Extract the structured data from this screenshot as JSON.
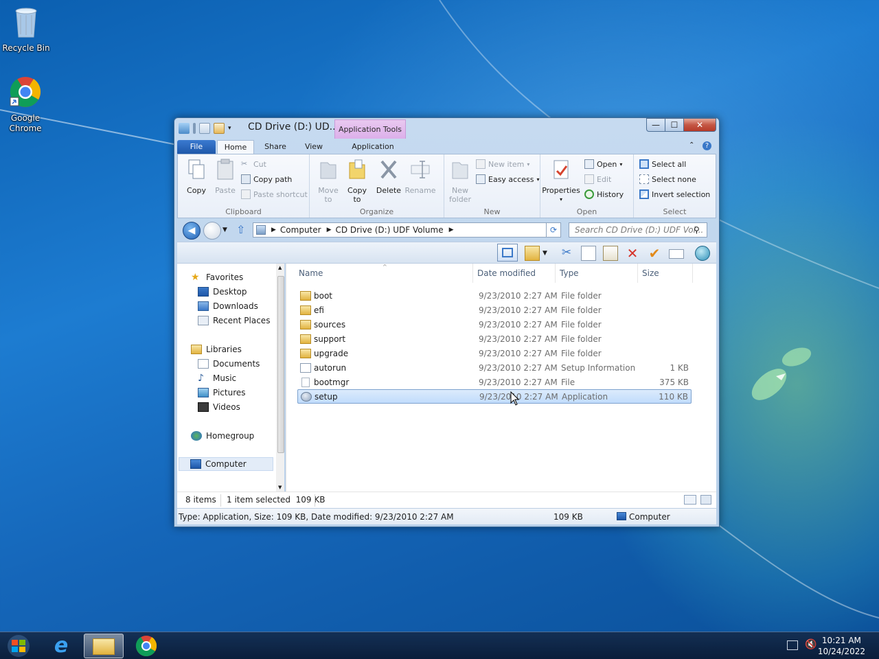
{
  "desktop": {
    "icons": [
      {
        "label": "Recycle Bin"
      },
      {
        "label": "Google Chrome"
      }
    ]
  },
  "window": {
    "title": "CD Drive (D:) UD...",
    "context_tab": "Application Tools",
    "controls": {
      "minimize": "—",
      "maximize": "☐",
      "close": "✕"
    },
    "tabs": {
      "file": "File",
      "home": "Home",
      "share": "Share",
      "view": "View",
      "application": "Application"
    }
  },
  "ribbon": {
    "clipboard": {
      "label": "Clipboard",
      "copy": "Copy",
      "paste": "Paste",
      "cut": "Cut",
      "copy_path": "Copy path",
      "paste_shortcut": "Paste shortcut"
    },
    "organize": {
      "label": "Organize",
      "move_to": "Move",
      "move_to2": "to",
      "copy_to": "Copy",
      "copy_to2": "to",
      "delete": "Delete",
      "rename": "Rename"
    },
    "new": {
      "label": "New",
      "new_folder": "New",
      "new_folder2": "folder",
      "new_item": "New item",
      "easy_access": "Easy access"
    },
    "open": {
      "label": "Open",
      "properties": "Properties",
      "open": "Open",
      "edit": "Edit",
      "history": "History"
    },
    "select": {
      "label": "Select",
      "select_all": "Select all",
      "select_none": "Select none",
      "invert": "Invert selection"
    }
  },
  "address": {
    "crumbs": [
      "Computer",
      "CD Drive (D:) UDF Volume"
    ],
    "search_placeholder": "Search CD Drive (D:) UDF Vol..."
  },
  "nav": {
    "favorites": "Favorites",
    "desktop": "Desktop",
    "downloads": "Downloads",
    "recent": "Recent Places",
    "libraries": "Libraries",
    "documents": "Documents",
    "music": "Music",
    "pictures": "Pictures",
    "videos": "Videos",
    "homegroup": "Homegroup",
    "computer": "Computer"
  },
  "columns": {
    "name": "Name",
    "date": "Date modified",
    "type": "Type",
    "size": "Size"
  },
  "files": [
    {
      "name": "boot",
      "date": "9/23/2010 2:27 AM",
      "type": "File folder",
      "size": ""
    },
    {
      "name": "efi",
      "date": "9/23/2010 2:27 AM",
      "type": "File folder",
      "size": ""
    },
    {
      "name": "sources",
      "date": "9/23/2010 2:27 AM",
      "type": "File folder",
      "size": ""
    },
    {
      "name": "support",
      "date": "9/23/2010 2:27 AM",
      "type": "File folder",
      "size": ""
    },
    {
      "name": "upgrade",
      "date": "9/23/2010 2:27 AM",
      "type": "File folder",
      "size": ""
    },
    {
      "name": "autorun",
      "date": "9/23/2010 2:27 AM",
      "type": "Setup Information",
      "size": "1 KB"
    },
    {
      "name": "bootmgr",
      "date": "9/23/2010 2:27 AM",
      "type": "File",
      "size": "375 KB"
    },
    {
      "name": "setup",
      "date": "9/23/2010 2:27 AM",
      "type": "Application",
      "size": "110 KB"
    }
  ],
  "status": {
    "items": "8 items",
    "selected": "1 item selected  109 KB",
    "details": "Type: Application, Size: 109 KB, Date modified: 9/23/2010 2:27 AM",
    "size": "109 KB",
    "location": "Computer"
  },
  "taskbar": {
    "time": "10:21 AM",
    "date": "10/24/2022"
  },
  "colors": {
    "accent": "#1d56a8",
    "selection": "#c1dcfc",
    "context_tab": "#dcb0ea"
  }
}
